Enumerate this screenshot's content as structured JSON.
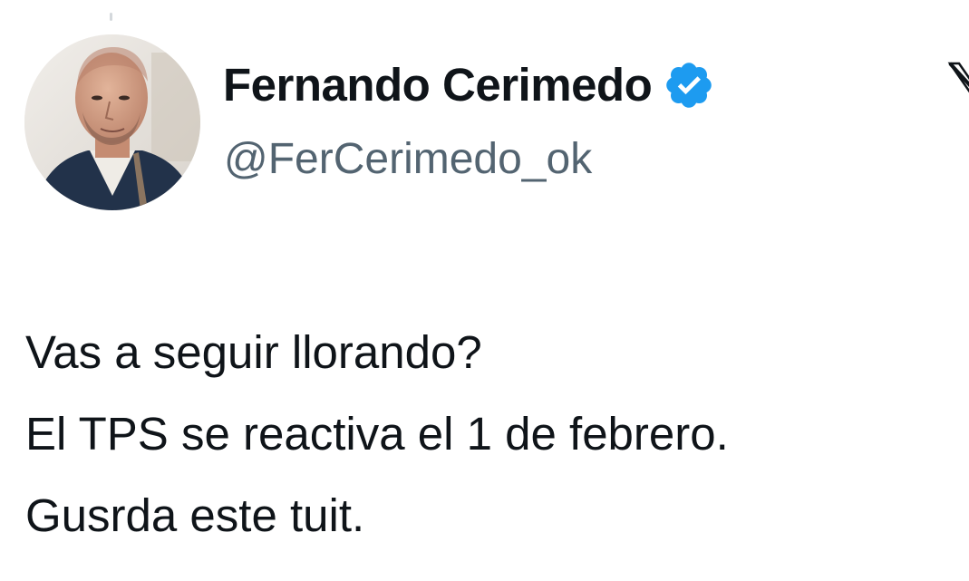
{
  "user": {
    "display_name": "Fernando Cerimedo",
    "handle": "@FerCerimedo_ok",
    "verified": true,
    "verified_color": "#1d9bf0"
  },
  "icons": {
    "verified": "verified-badge-icon",
    "brand": "x-logo-icon"
  },
  "tweet": {
    "lines": [
      "Vas a seguir llorando?",
      "El TPS se reactiva el 1 de febrero.",
      "Gusrda este tuit."
    ]
  },
  "colors": {
    "text_primary": "#0f1419",
    "text_secondary": "#536471",
    "background": "#ffffff"
  }
}
